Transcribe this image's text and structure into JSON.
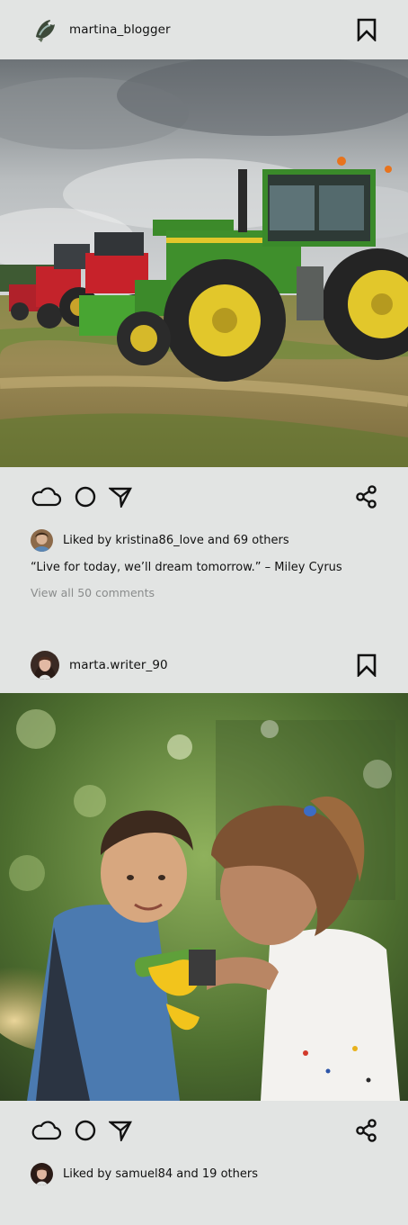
{
  "posts": [
    {
      "username": "martina_blogger",
      "avatar_icon": "bird-avatar",
      "photo_alt": "tractors in a field",
      "likes_text": "Liked by kristina86_love and 69 others",
      "caption": "“Live for today, we’ll dream tomorrow.” – Miley Cyrus",
      "comments_link": "View all 50 comments"
    },
    {
      "username": "marta.writer_90",
      "avatar_icon": "woman-avatar",
      "photo_alt": "children playing with a water sprayer",
      "likes_text": "Liked by samuel84 and 19 others"
    }
  ],
  "icons": {
    "like": "cloud-icon",
    "comment": "circle-icon",
    "send": "send-icon",
    "save": "bookmark-icon",
    "share": "share-icon"
  },
  "colors": {
    "background": "#e2e4e3",
    "text": "#111111",
    "muted": "#8a8c8c"
  }
}
